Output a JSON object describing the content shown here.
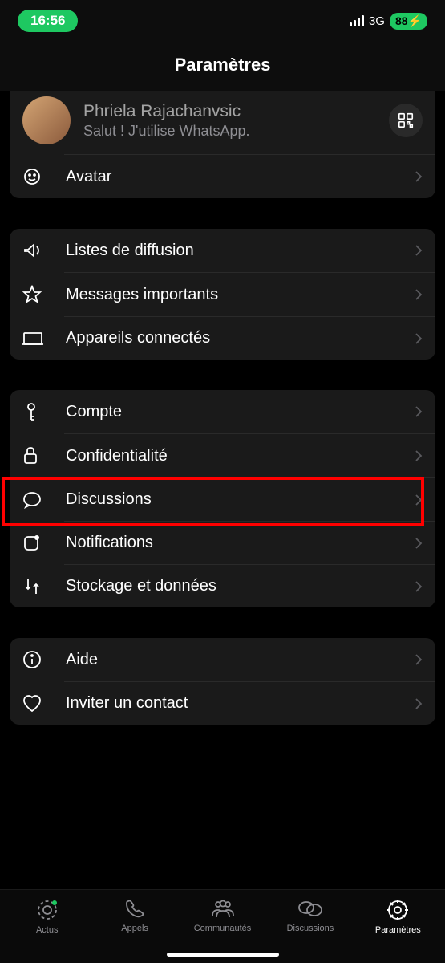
{
  "status": {
    "time": "16:56",
    "network": "3G",
    "battery": "88"
  },
  "header": {
    "title": "Paramètres"
  },
  "profile": {
    "name": "Phriela Rajachanvsic",
    "status_text": "Salut ! J'utilise WhatsApp."
  },
  "groups": [
    {
      "id": "profile_extra",
      "items": [
        {
          "icon": "avatar-icon",
          "label": "Avatar"
        }
      ]
    },
    {
      "id": "lists",
      "items": [
        {
          "icon": "broadcast-icon",
          "label": "Listes de diffusion"
        },
        {
          "icon": "star-icon",
          "label": "Messages importants"
        },
        {
          "icon": "devices-icon",
          "label": "Appareils connectés"
        }
      ]
    },
    {
      "id": "account",
      "items": [
        {
          "icon": "key-icon",
          "label": "Compte"
        },
        {
          "icon": "lock-icon",
          "label": "Confidentialité"
        },
        {
          "icon": "chat-icon",
          "label": "Discussions",
          "highlighted": true
        },
        {
          "icon": "notification-icon",
          "label": "Notifications"
        },
        {
          "icon": "storage-icon",
          "label": "Stockage et données"
        }
      ]
    },
    {
      "id": "help",
      "items": [
        {
          "icon": "info-icon",
          "label": "Aide"
        },
        {
          "icon": "heart-icon",
          "label": "Inviter un contact"
        }
      ]
    }
  ],
  "tabs": [
    {
      "icon": "updates-icon",
      "label": "Actus"
    },
    {
      "icon": "calls-icon",
      "label": "Appels"
    },
    {
      "icon": "communities-icon",
      "label": "Communautés"
    },
    {
      "icon": "discussions-icon",
      "label": "Discussions"
    },
    {
      "icon": "settings-icon",
      "label": "Paramètres",
      "active": true
    }
  ]
}
